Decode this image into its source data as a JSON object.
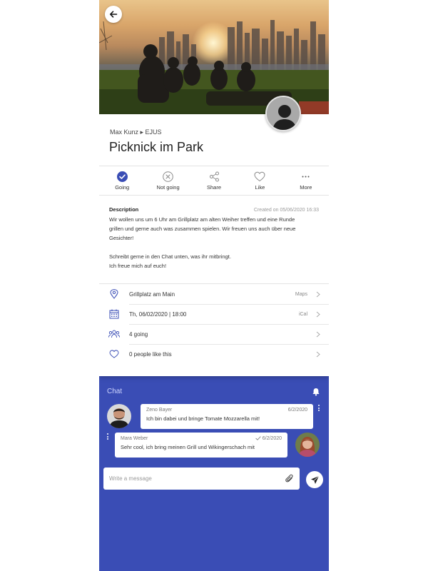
{
  "event": {
    "organizer": "Max Kunz ▸ EJUS",
    "title": "Picknick im Park"
  },
  "actions": [
    {
      "label": "Going",
      "icon": "check-circle-icon",
      "active": true
    },
    {
      "label": "Not going",
      "icon": "x-circle-icon"
    },
    {
      "label": "Share",
      "icon": "share-icon"
    },
    {
      "label": "Like",
      "icon": "heart-icon"
    },
    {
      "label": "More",
      "icon": "more-dots-icon"
    }
  ],
  "description": {
    "heading": "Description",
    "created": "Created on 05/06/2020 16:33",
    "paragraph1_line1": "Wir wollen uns um 6 Uhr am Grillplatz am alten Weiher treffen und eine Runde",
    "paragraph1_line2": "grillen und gerne auch was zusammen spielen. Wir freuen uns auch über neue",
    "paragraph1_line3": "Gesichter!",
    "paragraph2_line1": "Schreibt gerne in den Chat unten, was ihr mitbringt.",
    "paragraph2_line2": "Ich freue mich auf euch!"
  },
  "details": {
    "location": {
      "text": "Grillplatz am Main",
      "aux": "Maps"
    },
    "date": {
      "text": "Th, 06/02/2020 | 18:00",
      "aux": "iCal"
    },
    "going": {
      "text": "4 going"
    },
    "likes": {
      "text": "0 people like this"
    }
  },
  "chat": {
    "heading": "Chat",
    "messages": [
      {
        "author": "Zeno Bayer",
        "time": "6/2/2020",
        "text": "Ich bin dabei und bringe Tomate Mozzarella mit!"
      },
      {
        "author": "Mara Weber",
        "time": "6/2/2020",
        "text": "Sehr cool, ich bring meinen Grill und Wikingerschach mit"
      }
    ],
    "composer_placeholder": "Write a message"
  },
  "colors": {
    "accent": "#3a4db5",
    "icon_gray": "#8a8a8a",
    "card_bg": "#ffffff"
  }
}
